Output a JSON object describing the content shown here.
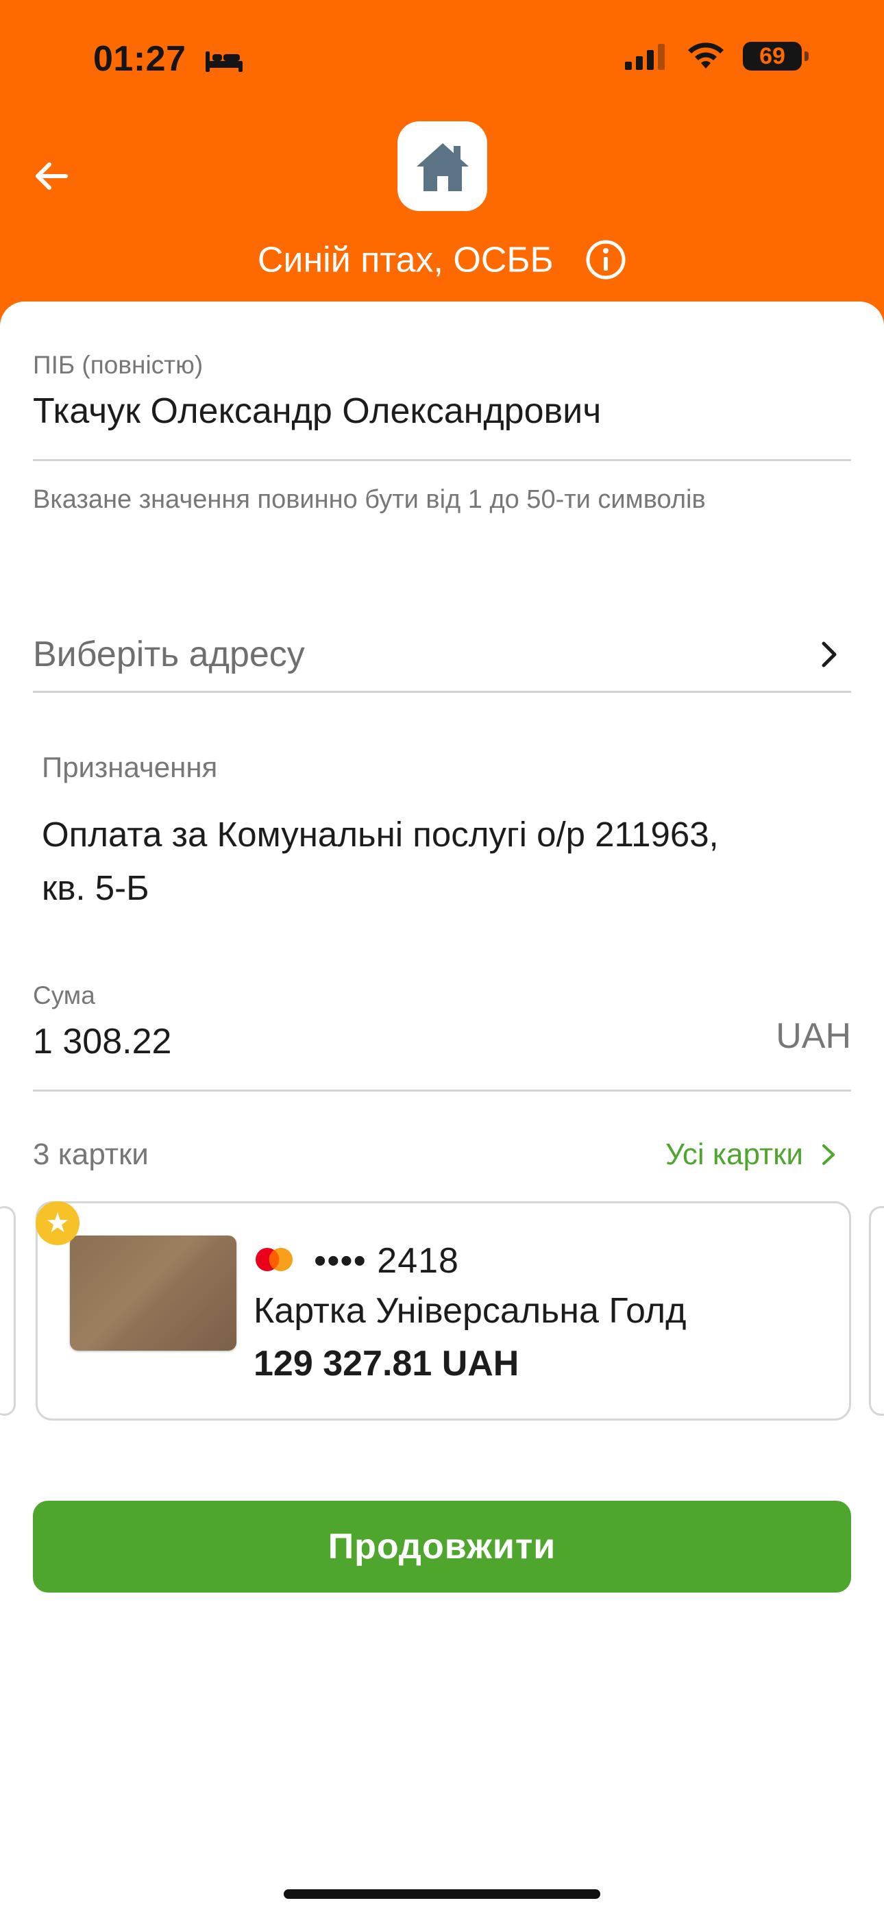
{
  "status_bar": {
    "time": "01:27",
    "battery": "69"
  },
  "header": {
    "title": "Синій птах, ОСББ",
    "icons": [
      "back-arrow-icon",
      "house-icon",
      "info-icon"
    ]
  },
  "form": {
    "name": {
      "label": "ПІБ (повністю)",
      "value": "Ткачук Олександр Олександрович",
      "hint": "Вказане значення повинно бути від 1 до 50-ти символів"
    },
    "address": {
      "placeholder": "Виберіть адресу"
    },
    "purpose": {
      "label": "Призначення",
      "line1": "Оплата за Комунальні послугі о/р 211963,",
      "line2": "кв. 5-Б"
    },
    "amount": {
      "label": "Сума",
      "value": "1 308.22",
      "currency": "UAH"
    }
  },
  "cards": {
    "count_label": "3 картки",
    "all_label": "Усі картки",
    "selected": {
      "masked": "•••• 2418",
      "name": "Картка Універсальна Голд",
      "balance": "129 327.81 UAH"
    }
  },
  "continue_label": "Продовжити",
  "colors": {
    "brand": "#ff6a00",
    "accent": "#4ea62c",
    "star": "#f6c227"
  }
}
